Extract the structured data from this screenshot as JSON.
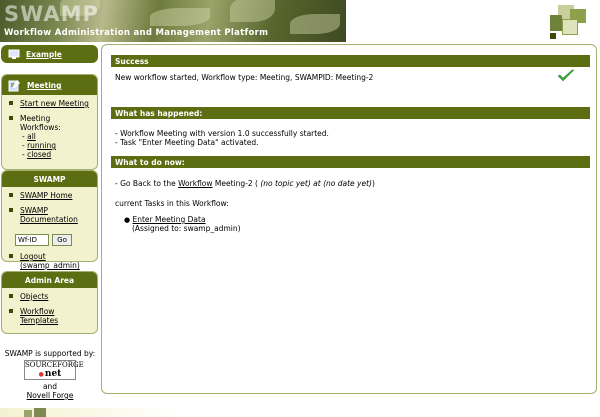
{
  "header": {
    "logo_text": "SWAMP",
    "subtitle": "Workflow Administration and Management Platform"
  },
  "sidebar": {
    "example": {
      "label": "Example"
    },
    "meeting": {
      "title": "Meeting",
      "start_new": "Start new Meeting",
      "workflows_label": "Meeting Workflows:",
      "filters": [
        "all",
        "running",
        "closed"
      ]
    },
    "swamp": {
      "title": "SWAMP",
      "home": "SWAMP Home",
      "documentation_line1": "SWAMP",
      "documentation_line2": "Documentation",
      "wfid_value": "Wf-ID",
      "go_button": "Go",
      "logout_line1": "Logout",
      "logout_line2": "(swamp_admin)"
    },
    "admin": {
      "title": "Admin Area",
      "objects": "Objects",
      "workflow_line1": "Workflow",
      "workflow_line2": "Templates"
    },
    "supported": {
      "text": "SWAMP is supported by:",
      "sf_line1": "SOURCEFORGE",
      "sf_line2": "net",
      "and": "and",
      "novell": "Novell Forge"
    }
  },
  "main": {
    "success_title": "Success",
    "success_message": "New workflow started, Workflow type: Meeting, SWAMPID: Meeting-2",
    "happened_title": "What has happened:",
    "happened_lines": [
      "- Workflow Meeting with version 1.0 successfully started.",
      "- Task \"Enter Meeting Data\" activated."
    ],
    "todo_title": "What to do now:",
    "goback_prefix": "- Go Back to the ",
    "goback_link": "Workflow",
    "goback_middle": " Meeting-2 ( ",
    "goback_italic": "(no topic yet) at (no date yet)",
    "goback_suffix": ")",
    "current_tasks": "current Tasks in this Workflow:",
    "task_link": "Enter Meeting Data",
    "task_assigned": "(Assigned to: swamp_admin)"
  },
  "colors": {
    "header_green": "#5d6e12",
    "sidebar_bg": "#f3f2cf",
    "check_green": "#3ea83e"
  }
}
